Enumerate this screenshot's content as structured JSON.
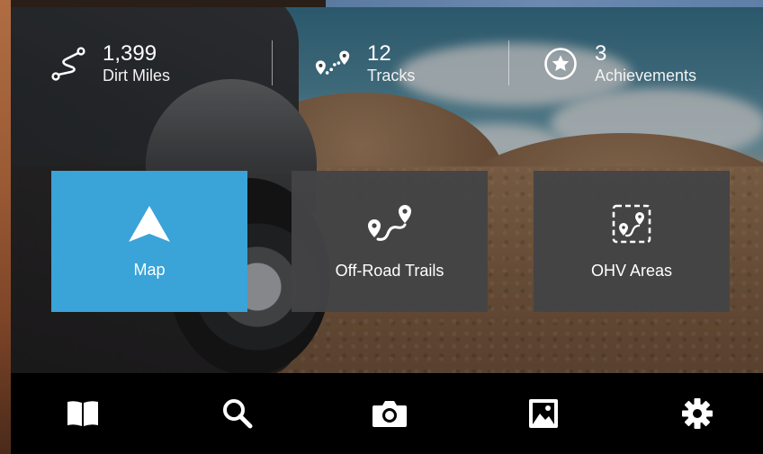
{
  "stats": [
    {
      "icon": "route-squiggle-icon",
      "value": "1,399",
      "label": "Dirt Miles"
    },
    {
      "icon": "track-pins-icon",
      "value": "12",
      "label": "Tracks"
    },
    {
      "icon": "star-badge-icon",
      "value": "3",
      "label": "Achievements"
    }
  ],
  "tiles": [
    {
      "id": "map",
      "icon": "navigation-arrow-icon",
      "label": "Map",
      "state": "selected"
    },
    {
      "id": "off-road-trails",
      "icon": "trail-route-icon",
      "label": "Off-Road Trails"
    },
    {
      "id": "ohv-areas",
      "icon": "area-boundary-icon",
      "label": "OHV Areas"
    }
  ],
  "tabbar": [
    {
      "id": "guide",
      "icon": "book-icon"
    },
    {
      "id": "search",
      "icon": "search-icon"
    },
    {
      "id": "camera",
      "icon": "camera-icon"
    },
    {
      "id": "gallery",
      "icon": "image-icon"
    },
    {
      "id": "settings",
      "icon": "gear-icon"
    }
  ],
  "colors": {
    "accent": "#3aa3d8",
    "tile_dark": "#444446",
    "tabbar": "#000000",
    "text": "#ffffff"
  }
}
